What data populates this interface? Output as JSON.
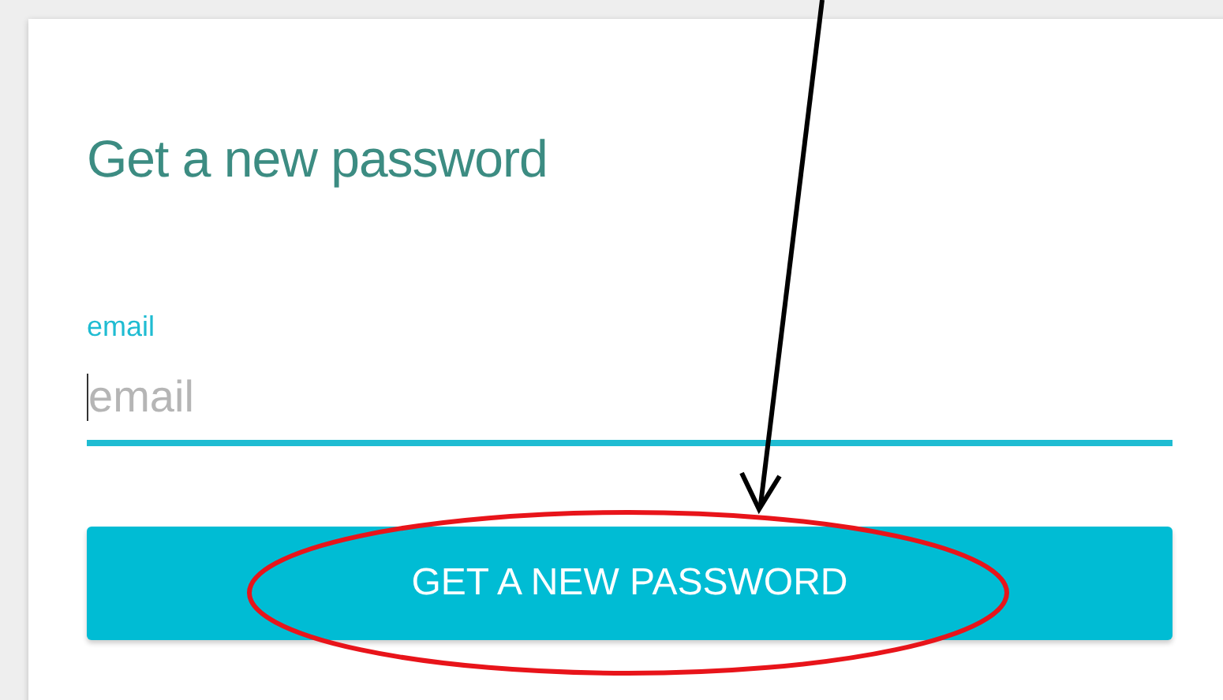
{
  "title": "Get a new password",
  "email_field": {
    "label": "email",
    "placeholder": "email",
    "focused": true
  },
  "submit_button": {
    "label": "GET A NEW PASSWORD"
  }
}
